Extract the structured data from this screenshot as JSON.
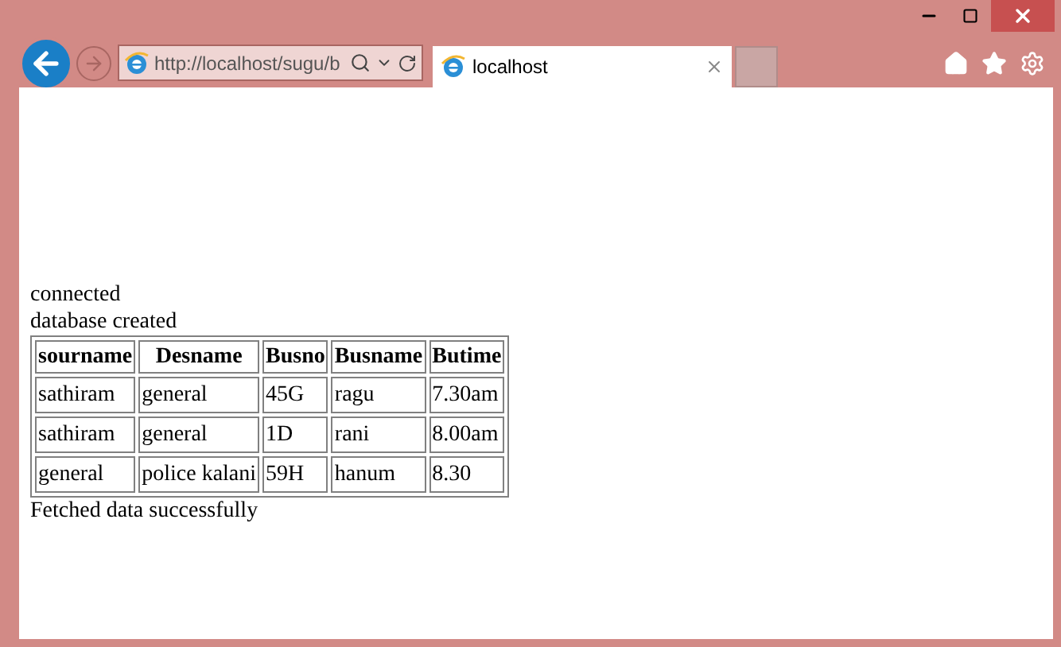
{
  "browser": {
    "address": "http://localhost/sugu/b",
    "tab_title": "localhost"
  },
  "messages_top": [
    "connected",
    "database created"
  ],
  "table": {
    "columns": [
      "sourname",
      "Desname",
      "Busno",
      "Busname",
      "Butime"
    ],
    "rows": [
      [
        "sathiram",
        "general",
        "45G",
        "ragu",
        "7.30am"
      ],
      [
        "sathiram",
        "general",
        "1D",
        "rani",
        "8.00am"
      ],
      [
        "general",
        "police kalani",
        "59H",
        "hanum",
        "8.30"
      ]
    ]
  },
  "message_bottom": "Fetched data successfully"
}
